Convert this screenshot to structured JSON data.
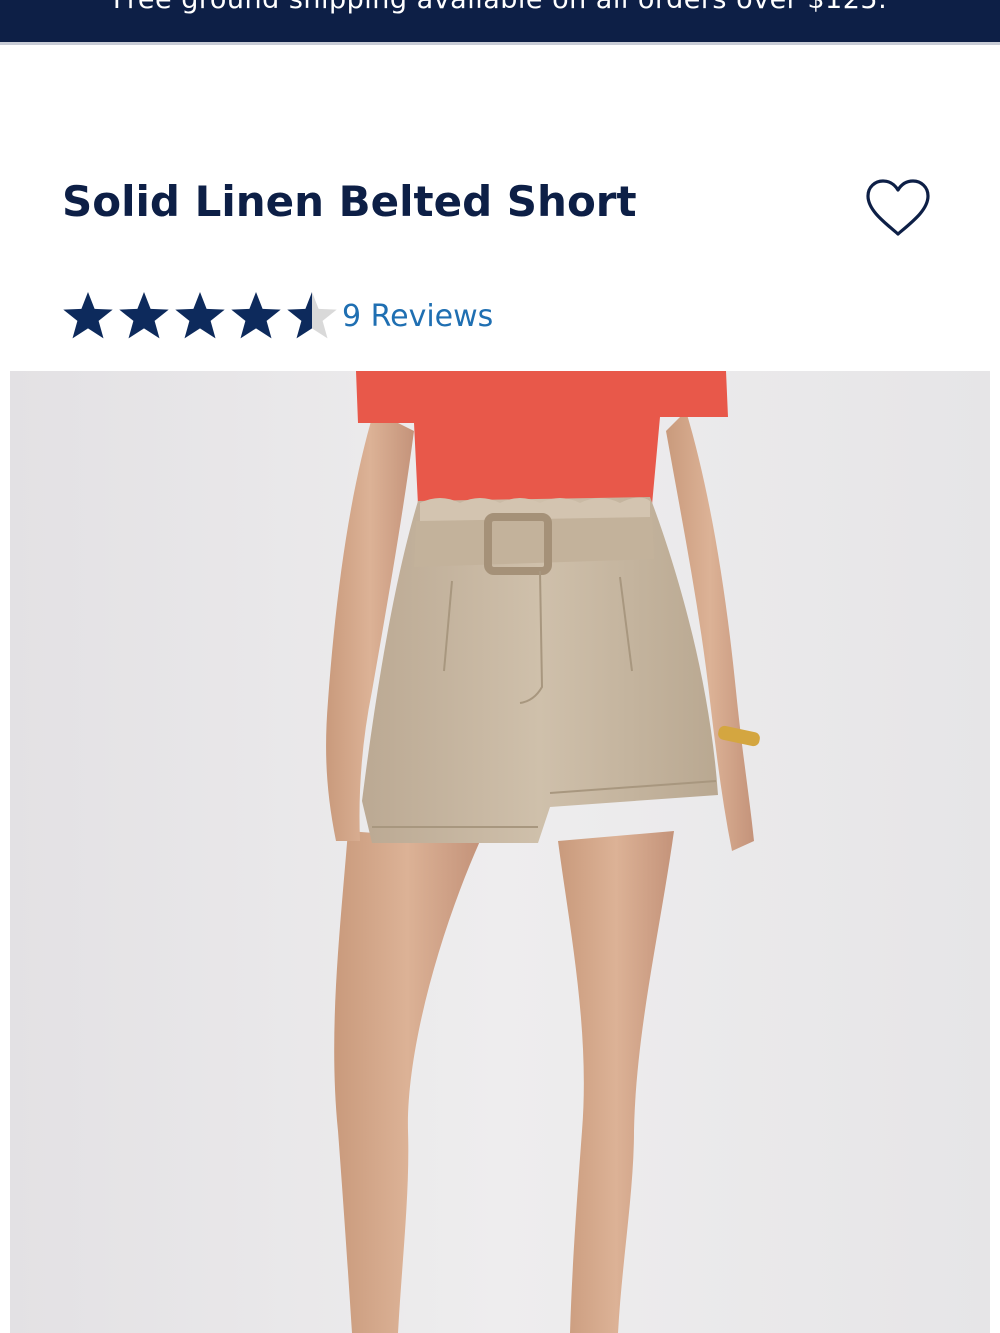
{
  "banner": {
    "text": "Free ground shipping available on all orders over $125."
  },
  "product": {
    "title": "Solid Linen Belted Short",
    "rating": 4.5,
    "rating_max": 5,
    "reviews_label": "9 Reviews"
  },
  "icons": {
    "wishlist": "heart-outline-icon",
    "rating": "star-icon"
  },
  "colors": {
    "brand_navy": "#0d1f46",
    "star_filled": "#0d2a5c",
    "star_empty": "#d9d9d9",
    "link_blue": "#1f6fb2",
    "top_coral": "#e8584a",
    "shorts_linen": "#c9b9a3",
    "photo_background": "#e9e8ea"
  }
}
